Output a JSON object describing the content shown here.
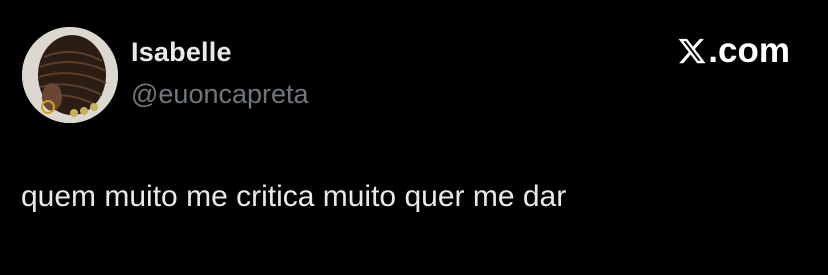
{
  "author": {
    "display_name": "Isabelle",
    "handle": "@euoncapreta",
    "avatar_icon": "profile-photo"
  },
  "brand": {
    "logo_icon": "x-logo-icon",
    "suffix": ".com"
  },
  "tweet": {
    "text": "quem muito me critica muito quer me dar"
  },
  "colors": {
    "background": "#000000",
    "primary_text": "#e7e9ea",
    "secondary_text": "#71767b",
    "brand": "#ffffff"
  }
}
